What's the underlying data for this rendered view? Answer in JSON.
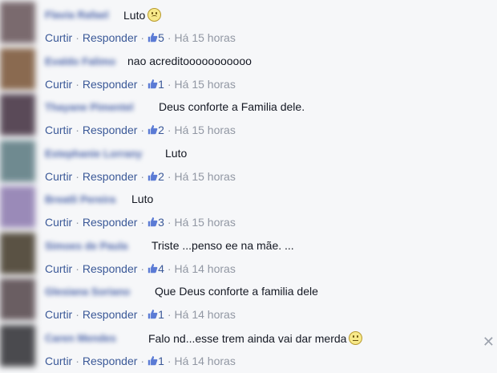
{
  "comments": [
    {
      "name": "Flavia Rafael",
      "text": "Luto",
      "emoji": "sad",
      "likes": "5",
      "time": "Há 15 horas",
      "avatar": "#7a6a6e"
    },
    {
      "name": "Evaldo Falimo",
      "text": "nao acreditooooooooooo",
      "emoji": "",
      "likes": "1",
      "time": "Há 15 horas",
      "avatar": "#8a6a50"
    },
    {
      "name": "Thayane Pimentel",
      "text": "Deus conforte a Familia dele.",
      "emoji": "",
      "likes": "2",
      "time": "Há 15 horas",
      "avatar": "#5a4a58"
    },
    {
      "name": "Estephanie Lorrany",
      "text": "Luto",
      "emoji": "",
      "likes": "2",
      "time": "Há 15 horas",
      "avatar": "#6f8a90"
    },
    {
      "name": "Breatli Pereira",
      "text": "Luto",
      "emoji": "",
      "likes": "3",
      "time": "Há 15 horas",
      "avatar": "#9a8ab8"
    },
    {
      "name": "Simoes de Paula",
      "text": "Triste ...penso ee na mãe. ...",
      "emoji": "",
      "likes": "4",
      "time": "Há 14 horas",
      "avatar": "#5a5244"
    },
    {
      "name": "Glesiana Soriano",
      "text": "Que Deus conforte a familia dele",
      "emoji": "",
      "likes": "1",
      "time": "Há 14 horas",
      "avatar": "#6a5e62"
    },
    {
      "name": "Caren Mendes",
      "text": "Falo nd...esse trem ainda vai dar merda",
      "emoji": "meh",
      "likes": "1",
      "time": "Há 14 horas",
      "avatar": "#4a4a4e"
    }
  ],
  "labels": {
    "like": "Curtir",
    "reply": "Responder",
    "dot": "·"
  },
  "close_icon": "close-icon",
  "colors": {
    "link": "#3b5998",
    "muted": "#9197a3",
    "background": "#f6f7f9"
  }
}
